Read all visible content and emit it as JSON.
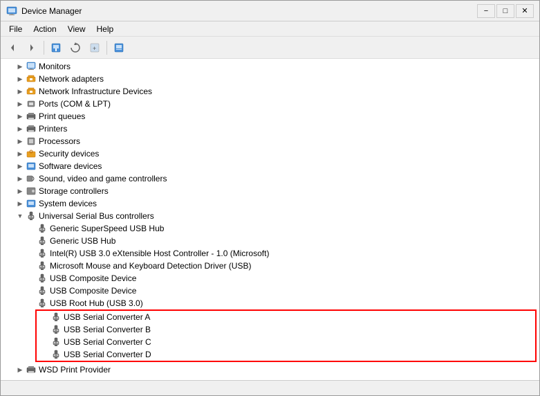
{
  "window": {
    "title": "Device Manager",
    "title_icon": "device-manager-icon"
  },
  "menu": {
    "items": [
      "File",
      "Action",
      "View",
      "Help"
    ]
  },
  "toolbar": {
    "buttons": [
      "←",
      "→",
      "🖥",
      "🔄",
      "📄",
      "🖥"
    ]
  },
  "tree": {
    "items": [
      {
        "id": "monitors",
        "label": "Monitors",
        "indent": 1,
        "icon": "monitor",
        "expanded": false
      },
      {
        "id": "network-adapters",
        "label": "Network adapters",
        "indent": 1,
        "icon": "net",
        "expanded": false
      },
      {
        "id": "network-infra",
        "label": "Network Infrastructure Devices",
        "indent": 1,
        "icon": "net",
        "expanded": false
      },
      {
        "id": "ports",
        "label": "Ports (COM & LPT)",
        "indent": 1,
        "icon": "port",
        "expanded": false
      },
      {
        "id": "print-queues",
        "label": "Print queues",
        "indent": 1,
        "icon": "print",
        "expanded": false
      },
      {
        "id": "printers",
        "label": "Printers",
        "indent": 1,
        "icon": "print",
        "expanded": false
      },
      {
        "id": "processors",
        "label": "Processors",
        "indent": 1,
        "icon": "proc",
        "expanded": false
      },
      {
        "id": "security",
        "label": "Security devices",
        "indent": 1,
        "icon": "sys",
        "expanded": false
      },
      {
        "id": "software",
        "label": "Software devices",
        "indent": 1,
        "icon": "sys",
        "expanded": false
      },
      {
        "id": "sound",
        "label": "Sound, video and game controllers",
        "indent": 1,
        "icon": "sound",
        "expanded": false
      },
      {
        "id": "storage",
        "label": "Storage controllers",
        "indent": 1,
        "icon": "storage",
        "expanded": false
      },
      {
        "id": "system",
        "label": "System devices",
        "indent": 1,
        "icon": "sys",
        "expanded": false
      },
      {
        "id": "usb",
        "label": "Universal Serial Bus controllers",
        "indent": 1,
        "icon": "usb",
        "expanded": true
      },
      {
        "id": "usb-superspeed",
        "label": "Generic SuperSpeed USB Hub",
        "indent": 2,
        "icon": "usb"
      },
      {
        "id": "usb-generic",
        "label": "Generic USB Hub",
        "indent": 2,
        "icon": "usb"
      },
      {
        "id": "usb-intel",
        "label": "Intel(R) USB 3.0 eXtensible Host Controller - 1.0 (Microsoft)",
        "indent": 2,
        "icon": "usb"
      },
      {
        "id": "usb-mouse",
        "label": "Microsoft Mouse and Keyboard Detection Driver (USB)",
        "indent": 2,
        "icon": "usb"
      },
      {
        "id": "usb-composite-1",
        "label": "USB Composite Device",
        "indent": 2,
        "icon": "usb"
      },
      {
        "id": "usb-composite-2",
        "label": "USB Composite Device",
        "indent": 2,
        "icon": "usb"
      },
      {
        "id": "usb-root",
        "label": "USB Root Hub (USB 3.0)",
        "indent": 2,
        "icon": "usb"
      },
      {
        "id": "usb-serial-a",
        "label": "USB Serial Converter A",
        "indent": 2,
        "icon": "usb",
        "highlight": true
      },
      {
        "id": "usb-serial-b",
        "label": "USB Serial Converter B",
        "indent": 2,
        "icon": "usb",
        "highlight": true
      },
      {
        "id": "usb-serial-c",
        "label": "USB Serial Converter C",
        "indent": 2,
        "icon": "usb",
        "highlight": true
      },
      {
        "id": "usb-serial-d",
        "label": "USB Serial Converter D",
        "indent": 2,
        "icon": "usb",
        "highlight": true
      },
      {
        "id": "wsd",
        "label": "WSD Print Provider",
        "indent": 1,
        "icon": "print",
        "expanded": false
      }
    ]
  },
  "status": ""
}
